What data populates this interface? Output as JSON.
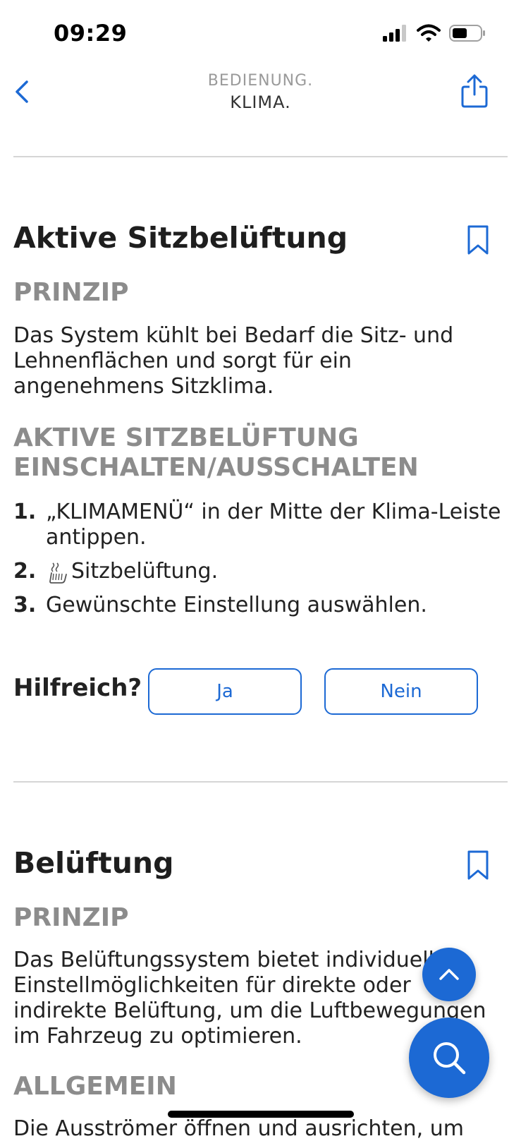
{
  "status_bar": {
    "time": "09:29"
  },
  "nav": {
    "subtitle": "BEDIENUNG.",
    "title": "KLIMA."
  },
  "section1": {
    "title": "Aktive Sitzbelüftung",
    "prinzip_label": "PRINZIP",
    "prinzip_text": "Das System kühlt bei Bedarf die Sitz- und Lehnenflächen und sorgt für ein angenehmens Sitzklima.",
    "toggle_heading": "AKTIVE SITZBELÜFTUNG EINSCHALTEN/AUSSCHALTEN",
    "steps": [
      {
        "num": "1.",
        "text": "„KLIMAMENÜ“ in der Mitte der Klima-Leiste antippen."
      },
      {
        "num": "2.",
        "text": "Sitzbelüftung."
      },
      {
        "num": "3.",
        "text": "Gewünschte Einstellung auswählen."
      }
    ],
    "helpful_label": "Hilfreich?",
    "yes_label": "Ja",
    "no_label": "Nein"
  },
  "section2": {
    "title": "Belüftung",
    "prinzip_label": "PRINZIP",
    "prinzip_text": "Das Belüftungssystem bietet individuelle Einstellmöglichkeiten für direkte oder indirekte Belüftung, um die Luftbewegungen im Fahrzeug zu optimieren.",
    "allgemein_label": "ALLGEMEIN",
    "allgemein_text_partial": "Die Ausströmer öffnen und ausrichten, um"
  },
  "colors": {
    "accent": "#1c69d4",
    "heading_gray": "#8c8c8c",
    "divider": "#d6d6d6"
  },
  "icons": {
    "back": "chevron-left-icon",
    "share": "share-icon",
    "bookmark": "bookmark-icon",
    "seat_ventilation": "seat-ventilation-icon",
    "scroll_top": "chevron-up-icon",
    "search": "search-icon"
  }
}
